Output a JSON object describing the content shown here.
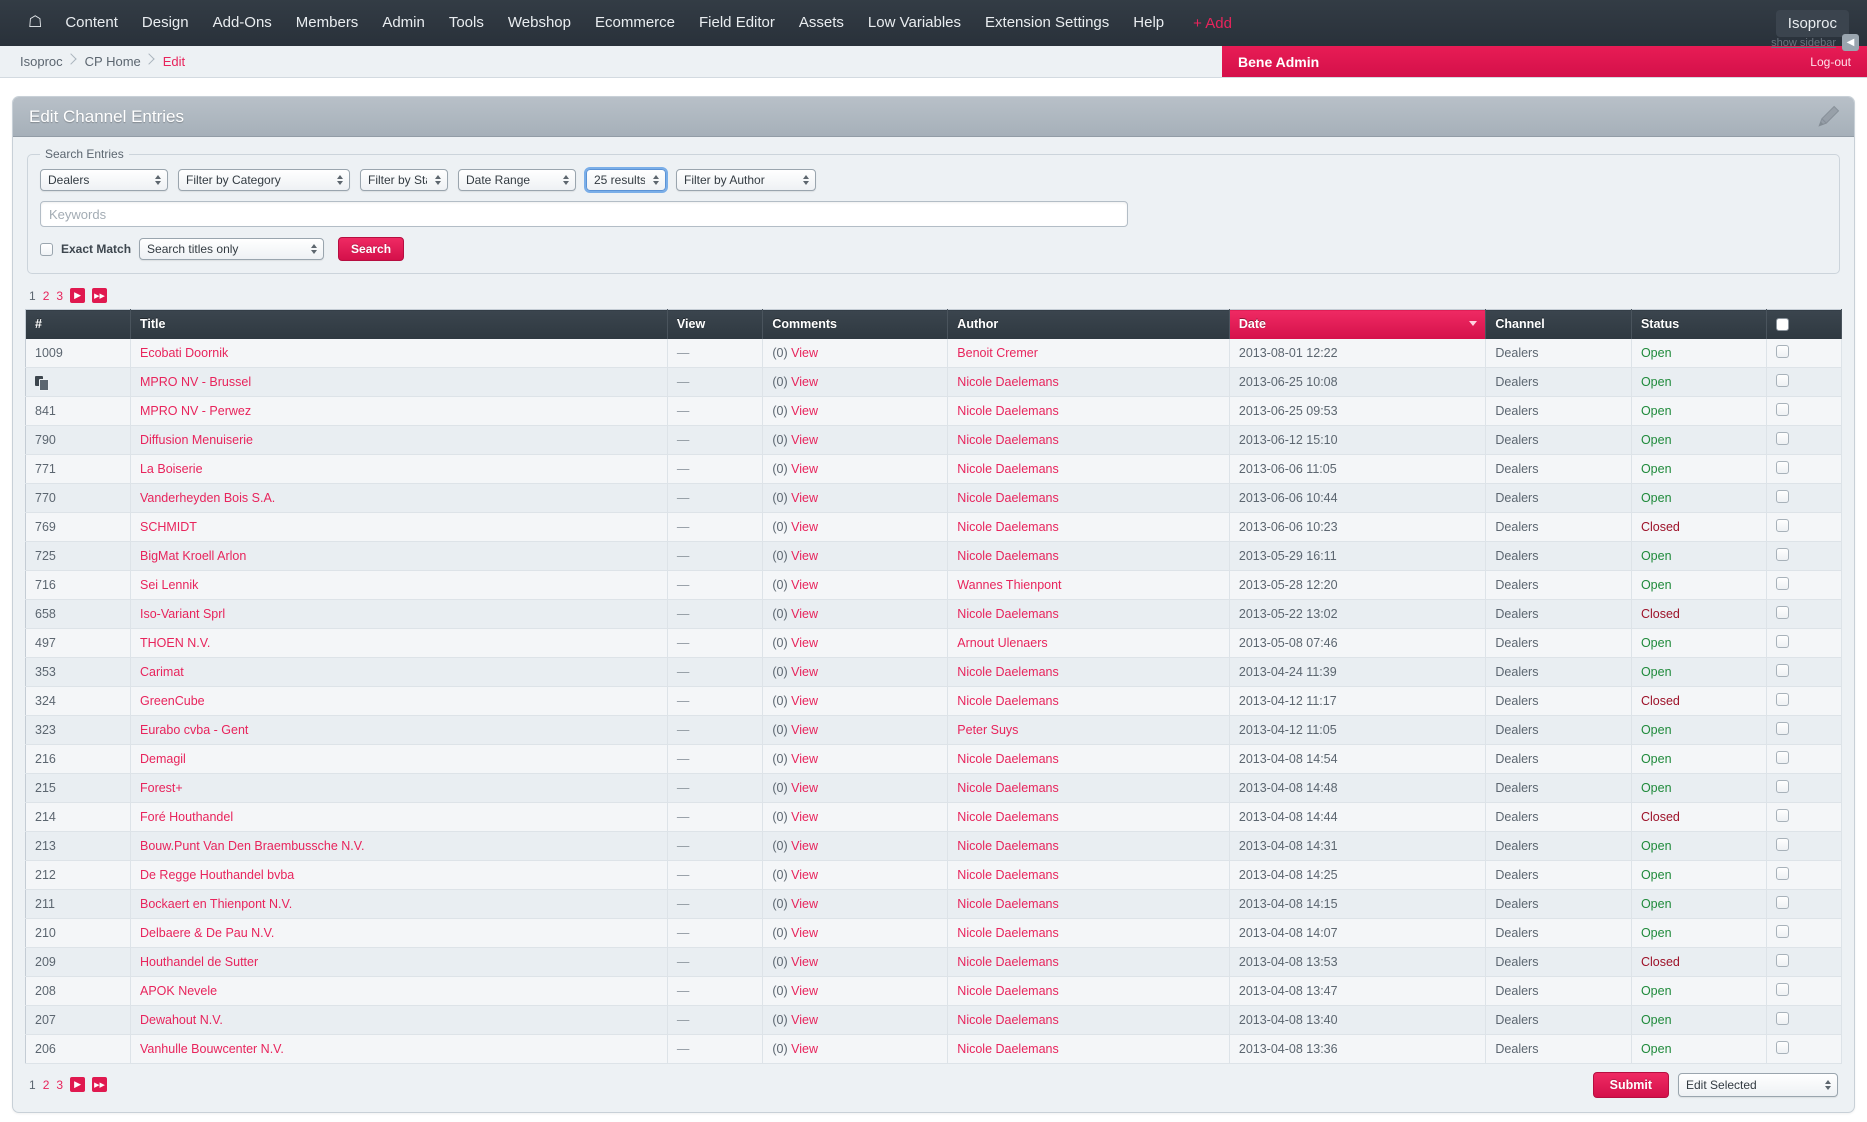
{
  "topnav": {
    "home_icon": "home-icon",
    "items": [
      "Content",
      "Design",
      "Add-Ons",
      "Members",
      "Admin",
      "Tools",
      "Webshop",
      "Ecommerce",
      "Field Editor",
      "Assets",
      "Low Variables",
      "Extension Settings",
      "Help"
    ],
    "add_label": "+ Add",
    "site_label": "Isoproc",
    "accent_color": "#e8245c"
  },
  "breadcrumb": {
    "items": [
      "Isoproc",
      "CP Home",
      "Edit"
    ]
  },
  "adminbar": {
    "name": "Bene Admin",
    "logout_label": "Log-out",
    "color": "#e0194f"
  },
  "sidebar_toggle": {
    "label": "show sidebar",
    "icon": "arrow-collapse-icon"
  },
  "panel": {
    "title": "Edit Channel Entries",
    "edit_icon": "pencil-icon"
  },
  "search": {
    "legend": "Search Entries",
    "filters": [
      {
        "name": "channel-filter",
        "value": "Dealers",
        "focused": false
      },
      {
        "name": "category-filter",
        "value": "Filter by Category",
        "focused": false
      },
      {
        "name": "status-filter",
        "value": "Filter by Status",
        "focused": false
      },
      {
        "name": "date-range-filter",
        "value": "Date Range",
        "focused": false
      },
      {
        "name": "results-count-filter",
        "value": "25 results",
        "focused": true
      },
      {
        "name": "author-filter",
        "value": "Filter by Author",
        "focused": false
      }
    ],
    "keywords_value": "",
    "keywords_placeholder": "Keywords",
    "exact_match_label": "Exact Match",
    "exact_match_checked": false,
    "scope_value": "Search titles only",
    "search_button": "Search"
  },
  "pagination": {
    "pages": [
      "1",
      "2",
      "3"
    ],
    "current": "1",
    "next_icon": "next-page-icon",
    "last_icon": "last-page-icon"
  },
  "table": {
    "columns": [
      "#",
      "Title",
      "View",
      "Comments",
      "Author",
      "Date",
      "Channel",
      "Status",
      ""
    ],
    "sorted_column": "Date",
    "sort_direction": "desc",
    "select_all_checked": false,
    "rows": [
      {
        "num": "1009",
        "num_is_icon": false,
        "title": "Ecobati Doornik",
        "view": "—",
        "comments_count": "(0)",
        "comments_link": "View",
        "author": "Benoit Cremer",
        "date": "2013-08-01 12:22",
        "channel": "Dealers",
        "status": "Open"
      },
      {
        "num": "",
        "num_is_icon": true,
        "title": "MPRO NV - Brussel",
        "view": "—",
        "comments_count": "(0)",
        "comments_link": "View",
        "author": "Nicole Daelemans",
        "date": "2013-06-25 10:08",
        "channel": "Dealers",
        "status": "Open"
      },
      {
        "num": "841",
        "num_is_icon": false,
        "title": "MPRO NV - Perwez",
        "view": "—",
        "comments_count": "(0)",
        "comments_link": "View",
        "author": "Nicole Daelemans",
        "date": "2013-06-25 09:53",
        "channel": "Dealers",
        "status": "Open"
      },
      {
        "num": "790",
        "num_is_icon": false,
        "title": "Diffusion Menuiserie",
        "view": "—",
        "comments_count": "(0)",
        "comments_link": "View",
        "author": "Nicole Daelemans",
        "date": "2013-06-12 15:10",
        "channel": "Dealers",
        "status": "Open"
      },
      {
        "num": "771",
        "num_is_icon": false,
        "title": "La Boiserie",
        "view": "—",
        "comments_count": "(0)",
        "comments_link": "View",
        "author": "Nicole Daelemans",
        "date": "2013-06-06 11:05",
        "channel": "Dealers",
        "status": "Open"
      },
      {
        "num": "770",
        "num_is_icon": false,
        "title": "Vanderheyden Bois S.A.",
        "view": "—",
        "comments_count": "(0)",
        "comments_link": "View",
        "author": "Nicole Daelemans",
        "date": "2013-06-06 10:44",
        "channel": "Dealers",
        "status": "Open"
      },
      {
        "num": "769",
        "num_is_icon": false,
        "title": "SCHMIDT",
        "view": "—",
        "comments_count": "(0)",
        "comments_link": "View",
        "author": "Nicole Daelemans",
        "date": "2013-06-06 10:23",
        "channel": "Dealers",
        "status": "Closed"
      },
      {
        "num": "725",
        "num_is_icon": false,
        "title": "BigMat Kroell Arlon",
        "view": "—",
        "comments_count": "(0)",
        "comments_link": "View",
        "author": "Nicole Daelemans",
        "date": "2013-05-29 16:11",
        "channel": "Dealers",
        "status": "Open"
      },
      {
        "num": "716",
        "num_is_icon": false,
        "title": "Sei Lennik",
        "view": "—",
        "comments_count": "(0)",
        "comments_link": "View",
        "author": "Wannes Thienpont",
        "date": "2013-05-28 12:20",
        "channel": "Dealers",
        "status": "Open"
      },
      {
        "num": "658",
        "num_is_icon": false,
        "title": "Iso-Variant Sprl",
        "view": "—",
        "comments_count": "(0)",
        "comments_link": "View",
        "author": "Nicole Daelemans",
        "date": "2013-05-22 13:02",
        "channel": "Dealers",
        "status": "Closed"
      },
      {
        "num": "497",
        "num_is_icon": false,
        "title": "THOEN N.V.",
        "view": "—",
        "comments_count": "(0)",
        "comments_link": "View",
        "author": "Arnout Ulenaers",
        "date": "2013-05-08 07:46",
        "channel": "Dealers",
        "status": "Open"
      },
      {
        "num": "353",
        "num_is_icon": false,
        "title": "Carimat",
        "view": "—",
        "comments_count": "(0)",
        "comments_link": "View",
        "author": "Nicole Daelemans",
        "date": "2013-04-24 11:39",
        "channel": "Dealers",
        "status": "Open"
      },
      {
        "num": "324",
        "num_is_icon": false,
        "title": "GreenCube",
        "view": "—",
        "comments_count": "(0)",
        "comments_link": "View",
        "author": "Nicole Daelemans",
        "date": "2013-04-12 11:17",
        "channel": "Dealers",
        "status": "Closed"
      },
      {
        "num": "323",
        "num_is_icon": false,
        "title": "Eurabo cvba - Gent",
        "view": "—",
        "comments_count": "(0)",
        "comments_link": "View",
        "author": "Peter Suys",
        "date": "2013-04-12 11:05",
        "channel": "Dealers",
        "status": "Open"
      },
      {
        "num": "216",
        "num_is_icon": false,
        "title": "Demagil",
        "view": "—",
        "comments_count": "(0)",
        "comments_link": "View",
        "author": "Nicole Daelemans",
        "date": "2013-04-08 14:54",
        "channel": "Dealers",
        "status": "Open"
      },
      {
        "num": "215",
        "num_is_icon": false,
        "title": "Forest+",
        "view": "—",
        "comments_count": "(0)",
        "comments_link": "View",
        "author": "Nicole Daelemans",
        "date": "2013-04-08 14:48",
        "channel": "Dealers",
        "status": "Open"
      },
      {
        "num": "214",
        "num_is_icon": false,
        "title": "Foré Houthandel",
        "view": "—",
        "comments_count": "(0)",
        "comments_link": "View",
        "author": "Nicole Daelemans",
        "date": "2013-04-08 14:44",
        "channel": "Dealers",
        "status": "Closed"
      },
      {
        "num": "213",
        "num_is_icon": false,
        "title": "Bouw.Punt Van Den Braembussche N.V.",
        "view": "—",
        "comments_count": "(0)",
        "comments_link": "View",
        "author": "Nicole Daelemans",
        "date": "2013-04-08 14:31",
        "channel": "Dealers",
        "status": "Open"
      },
      {
        "num": "212",
        "num_is_icon": false,
        "title": "De Regge Houthandel bvba",
        "view": "—",
        "comments_count": "(0)",
        "comments_link": "View",
        "author": "Nicole Daelemans",
        "date": "2013-04-08 14:25",
        "channel": "Dealers",
        "status": "Open"
      },
      {
        "num": "211",
        "num_is_icon": false,
        "title": "Bockaert en Thienpont N.V.",
        "view": "—",
        "comments_count": "(0)",
        "comments_link": "View",
        "author": "Nicole Daelemans",
        "date": "2013-04-08 14:15",
        "channel": "Dealers",
        "status": "Open"
      },
      {
        "num": "210",
        "num_is_icon": false,
        "title": "Delbaere & De Pau N.V.",
        "view": "—",
        "comments_count": "(0)",
        "comments_link": "View",
        "author": "Nicole Daelemans",
        "date": "2013-04-08 14:07",
        "channel": "Dealers",
        "status": "Open"
      },
      {
        "num": "209",
        "num_is_icon": false,
        "title": "Houthandel de Sutter",
        "view": "—",
        "comments_count": "(0)",
        "comments_link": "View",
        "author": "Nicole Daelemans",
        "date": "2013-04-08 13:53",
        "channel": "Dealers",
        "status": "Closed"
      },
      {
        "num": "208",
        "num_is_icon": false,
        "title": "APOK Nevele",
        "view": "—",
        "comments_count": "(0)",
        "comments_link": "View",
        "author": "Nicole Daelemans",
        "date": "2013-04-08 13:47",
        "channel": "Dealers",
        "status": "Open"
      },
      {
        "num": "207",
        "num_is_icon": false,
        "title": "Dewahout N.V.",
        "view": "—",
        "comments_count": "(0)",
        "comments_link": "View",
        "author": "Nicole Daelemans",
        "date": "2013-04-08 13:40",
        "channel": "Dealers",
        "status": "Open"
      },
      {
        "num": "206",
        "num_is_icon": false,
        "title": "Vanhulle Bouwcenter N.V.",
        "view": "—",
        "comments_count": "(0)",
        "comments_link": "View",
        "author": "Nicole Daelemans",
        "date": "2013-04-08 13:36",
        "channel": "Dealers",
        "status": "Open"
      }
    ]
  },
  "footer": {
    "submit_label": "Submit",
    "action_value": "Edit Selected"
  }
}
